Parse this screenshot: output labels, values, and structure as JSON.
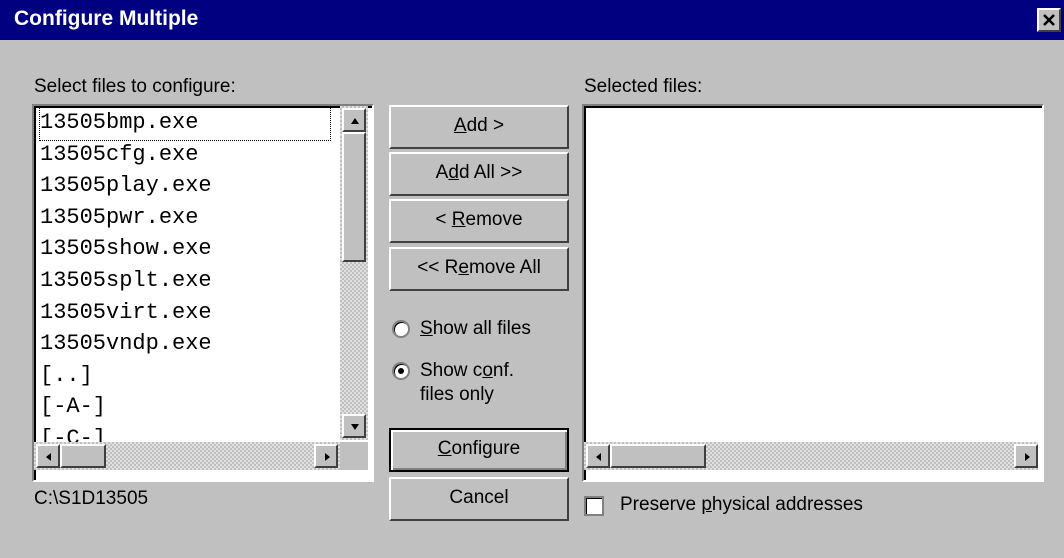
{
  "window": {
    "title": "Configure Multiple",
    "close_glyph": "✕"
  },
  "left": {
    "label": "Select files to configure:",
    "files": [
      "13505bmp.exe",
      "13505cfg.exe",
      "13505play.exe",
      "13505pwr.exe",
      "13505show.exe",
      "13505splt.exe",
      "13505virt.exe",
      "13505vndp.exe",
      "[..]",
      "[-A-]",
      "[-C-]"
    ],
    "path": "C:\\S1D13505"
  },
  "buttons": {
    "add": {
      "pre": "",
      "key": "A",
      "post": "dd >"
    },
    "add_all": {
      "pre": "A",
      "key": "d",
      "post": "d All >>"
    },
    "remove": {
      "pre": "< ",
      "key": "R",
      "post": "emove"
    },
    "remove_all": {
      "pre": "<< R",
      "key": "e",
      "post": "move All"
    },
    "configure": {
      "pre": "",
      "key": "C",
      "post": "onfigure"
    },
    "cancel": "Cancel"
  },
  "filter": {
    "show_all": {
      "pre": "",
      "key": "S",
      "post": "how all files",
      "selected": false
    },
    "show_conf": {
      "line1_pre": "Show c",
      "line1_key": "o",
      "line1_post": "nf.",
      "line2": "files only",
      "selected": true
    }
  },
  "right": {
    "label": "Selected files:",
    "preserve": {
      "pre": "Preserve ",
      "key": "p",
      "post": "hysical addresses",
      "checked": false
    }
  }
}
